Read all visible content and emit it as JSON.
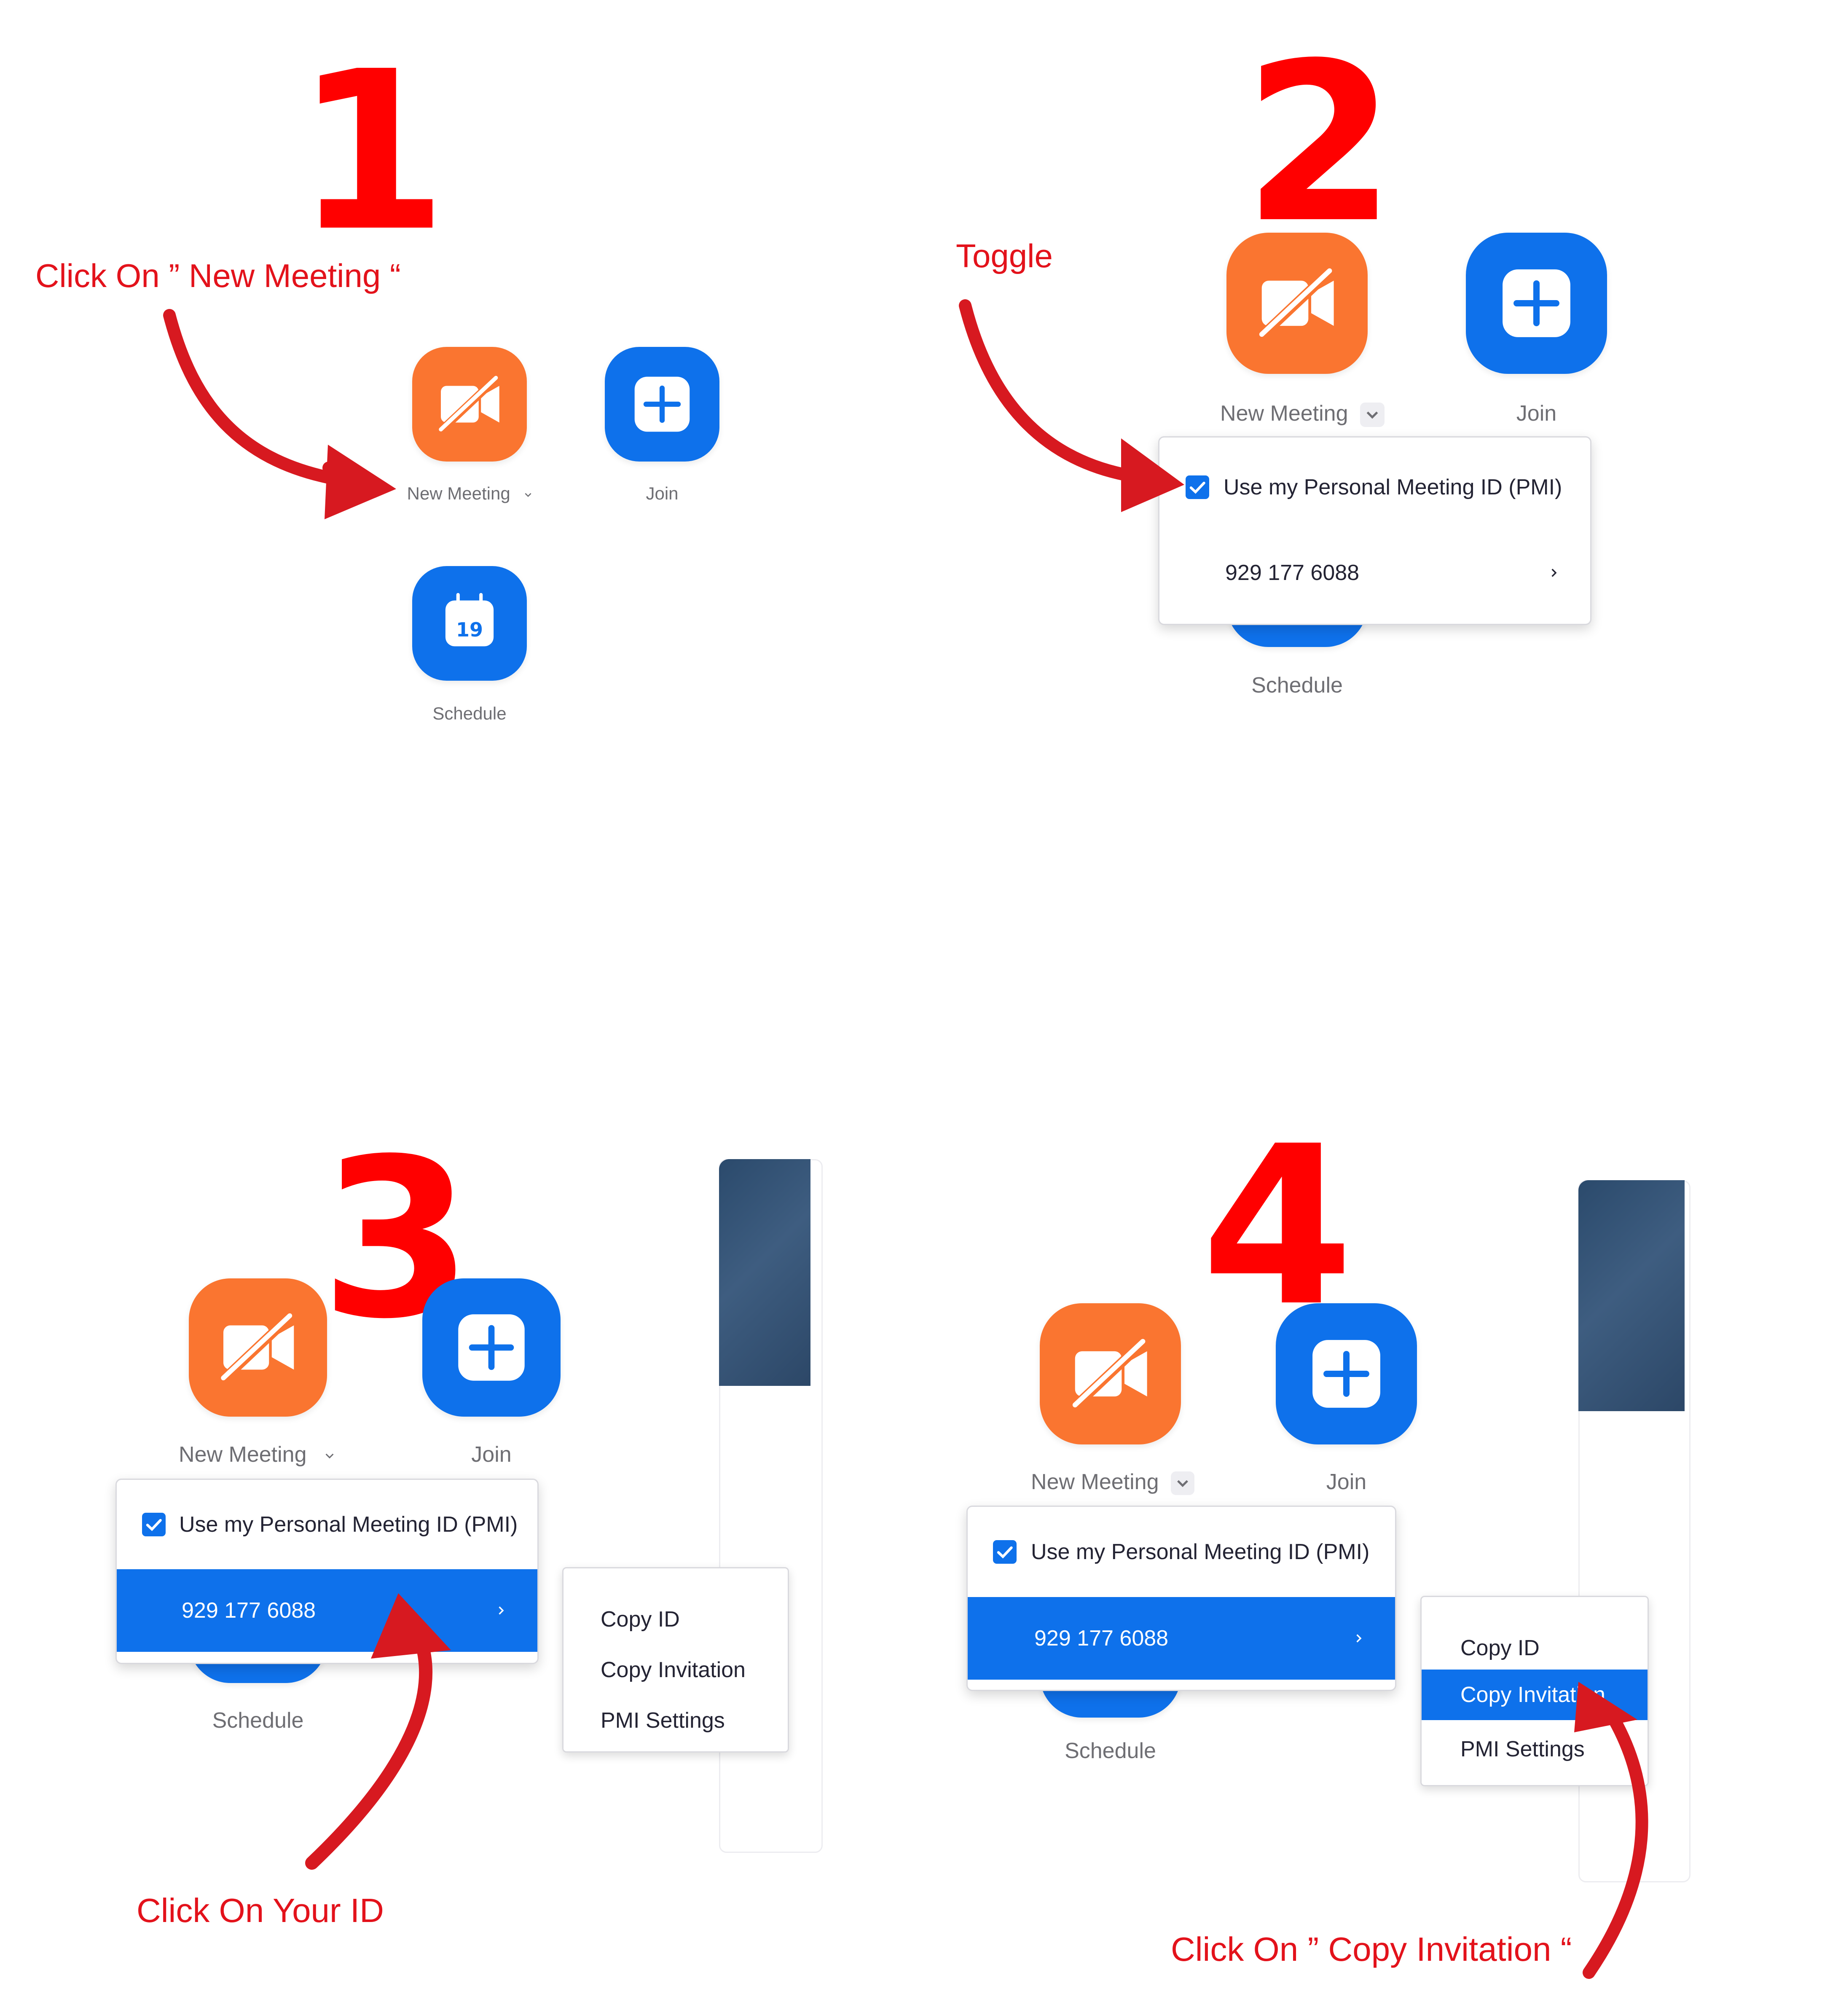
{
  "steps": [
    {
      "number": "1",
      "instruction": "Click On ” New Meeting “",
      "buttons": {
        "new_meeting": "New Meeting",
        "join": "Join",
        "schedule": "Schedule",
        "calendar_day": "19"
      }
    },
    {
      "number": "2",
      "instruction": "Toggle",
      "buttons": {
        "new_meeting": "New Meeting",
        "join": "Join",
        "schedule": "Schedule"
      },
      "menu": {
        "pmi_checkbox_label": "Use my Personal Meeting ID (PMI)",
        "pmi_checked": true,
        "pmi_number": "929 177 6088"
      }
    },
    {
      "number": "3",
      "instruction": "Click On  Your ID",
      "buttons": {
        "new_meeting": "New Meeting",
        "join": "Join",
        "schedule": "Schedule"
      },
      "menu": {
        "pmi_checkbox_label": "Use my Personal Meeting ID (PMI)",
        "pmi_checked": true,
        "pmi_number": "929 177 6088"
      },
      "submenu": [
        "Copy ID",
        "Copy Invitation",
        "PMI Settings"
      ]
    },
    {
      "number": "4",
      "instruction": "Click On ” Copy Invitation “",
      "buttons": {
        "new_meeting": "New Meeting",
        "join": "Join",
        "schedule": "Schedule"
      },
      "menu": {
        "pmi_checkbox_label": "Use my Personal Meeting ID (PMI)",
        "pmi_checked": true,
        "pmi_number": "929 177 6088"
      },
      "submenu": [
        "Copy ID",
        "Copy Invitation",
        "PMI Settings"
      ],
      "submenu_highlighted": "Copy Invitation"
    }
  ],
  "colors": {
    "step_number": "#ff0000",
    "instruction": "#e3121b",
    "arrow": "#d71920",
    "new_meeting_button": "#fa7530",
    "zoom_blue": "#0e71eb",
    "label_gray": "#6e6e73"
  },
  "icons": {
    "new_meeting": "video-off-icon",
    "join": "plus-icon",
    "schedule": "calendar-icon",
    "dropdown": "chevron-down-icon",
    "submenu": "chevron-right-icon",
    "checkbox": "checkmark-icon"
  }
}
